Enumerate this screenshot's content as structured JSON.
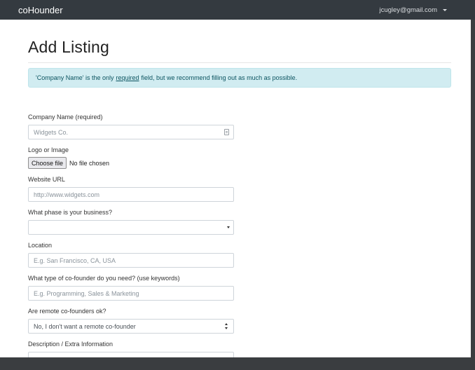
{
  "navbar": {
    "brand": "coHounder",
    "user_email": "jcugley@gmail.com"
  },
  "page": {
    "title": "Add Listing",
    "alert": {
      "before": "'Company Name' is the only",
      "link": "required",
      "after": "field, but we recommend filling out as much as possible."
    }
  },
  "form": {
    "company_name": {
      "label": "Company Name (required)",
      "placeholder": "Widgets Co."
    },
    "logo": {
      "label": "Logo or Image",
      "button": "Choose file",
      "status": "No file chosen"
    },
    "website": {
      "label": "Website URL",
      "placeholder": "http://www.widgets.com"
    },
    "phase": {
      "label": "What phase is your business?",
      "value": ""
    },
    "location": {
      "label": "Location",
      "placeholder": "E.g. San Francisco, CA, USA"
    },
    "cofounder_type": {
      "label": "What type of co-founder do you need? (use keywords)",
      "placeholder": "E.g. Programming, Sales & Marketing"
    },
    "remote": {
      "label": "Are remote co-founders ok?",
      "value": "No, I don't want a remote co-founder"
    },
    "description": {
      "label": "Description / Extra Information"
    }
  },
  "colors": {
    "navbar": "#343a40",
    "alert_bg": "#d1ecf1",
    "alert_text": "#0c5460"
  },
  "icons": {
    "company_input_icon": "contact-card-icon",
    "phase_select": "chevron-down-icon",
    "remote_select": "up-down-arrows-icon",
    "user_menu": "caret-down-icon"
  }
}
